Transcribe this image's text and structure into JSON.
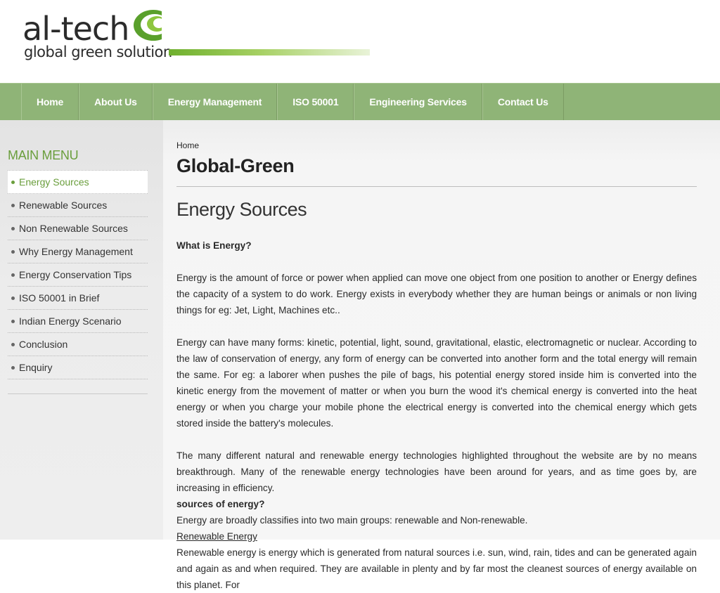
{
  "brand": {
    "name": "al-tech",
    "tagline": "global green solution",
    "accent": "#6fb02e",
    "nav_color": "#8fb477",
    "menu_accent": "#6a9e3c"
  },
  "nav": {
    "items": [
      {
        "label": "Home"
      },
      {
        "label": "About Us"
      },
      {
        "label": "Energy Management"
      },
      {
        "label": "ISO 50001"
      },
      {
        "label": "Engineering Services"
      },
      {
        "label": "Contact Us"
      }
    ]
  },
  "sidebar": {
    "title": "MAIN MENU",
    "items": [
      {
        "label": "Energy Sources"
      },
      {
        "label": "Renewable Sources"
      },
      {
        "label": "Non Renewable Sources"
      },
      {
        "label": "Why Energy Management"
      },
      {
        "label": "Energy Conservation Tips"
      },
      {
        "label": "ISO 50001 in Brief"
      },
      {
        "label": "Indian Energy Scenario"
      },
      {
        "label": "Conclusion"
      },
      {
        "label": "Enquiry"
      }
    ]
  },
  "main": {
    "breadcrumb": "Home",
    "page_title": "Global-Green",
    "section_title": "Energy Sources",
    "question1": "What is Energy?",
    "para1": "Energy is the amount of force or power when applied can move one object from one position to another or Energy defines the capacity of a system to do work. Energy exists in everybody whether they are human beings or animals or non living things for eg: Jet, Light, Machines etc..",
    "para2": "Energy can have many forms: kinetic, potential, light, sound, gravitational, elastic, electromagnetic or nuclear. According to the law of conservation of energy, any form of energy can be converted into another form and the total energy will remain the same. For eg: a laborer when pushes the pile of bags, his potential energy stored inside him is converted into the kinetic energy from the movement of matter or when you burn the wood it's chemical energy is converted into the heat energy or when you charge your mobile phone the electrical energy is converted into the chemical energy which gets stored inside the battery's molecules.",
    "para3": "The many different natural and renewable energy technologies highlighted throughout the website are by no means breakthrough. Many of the renewable energy technologies have been around for years, and as time goes by, are increasing in efficiency.",
    "question2": "sources of energy?",
    "para4": "Energy are broadly classifies into two main groups: renewable and Non-renewable.",
    "subheading": "Renewable Energy",
    "para5": "Renewable energy is energy which is generated from natural sources i.e. sun, wind, rain, tides and can be generated again and again as and when required. They are available in plenty and by far most the cleanest sources of energy available on this planet. For"
  }
}
